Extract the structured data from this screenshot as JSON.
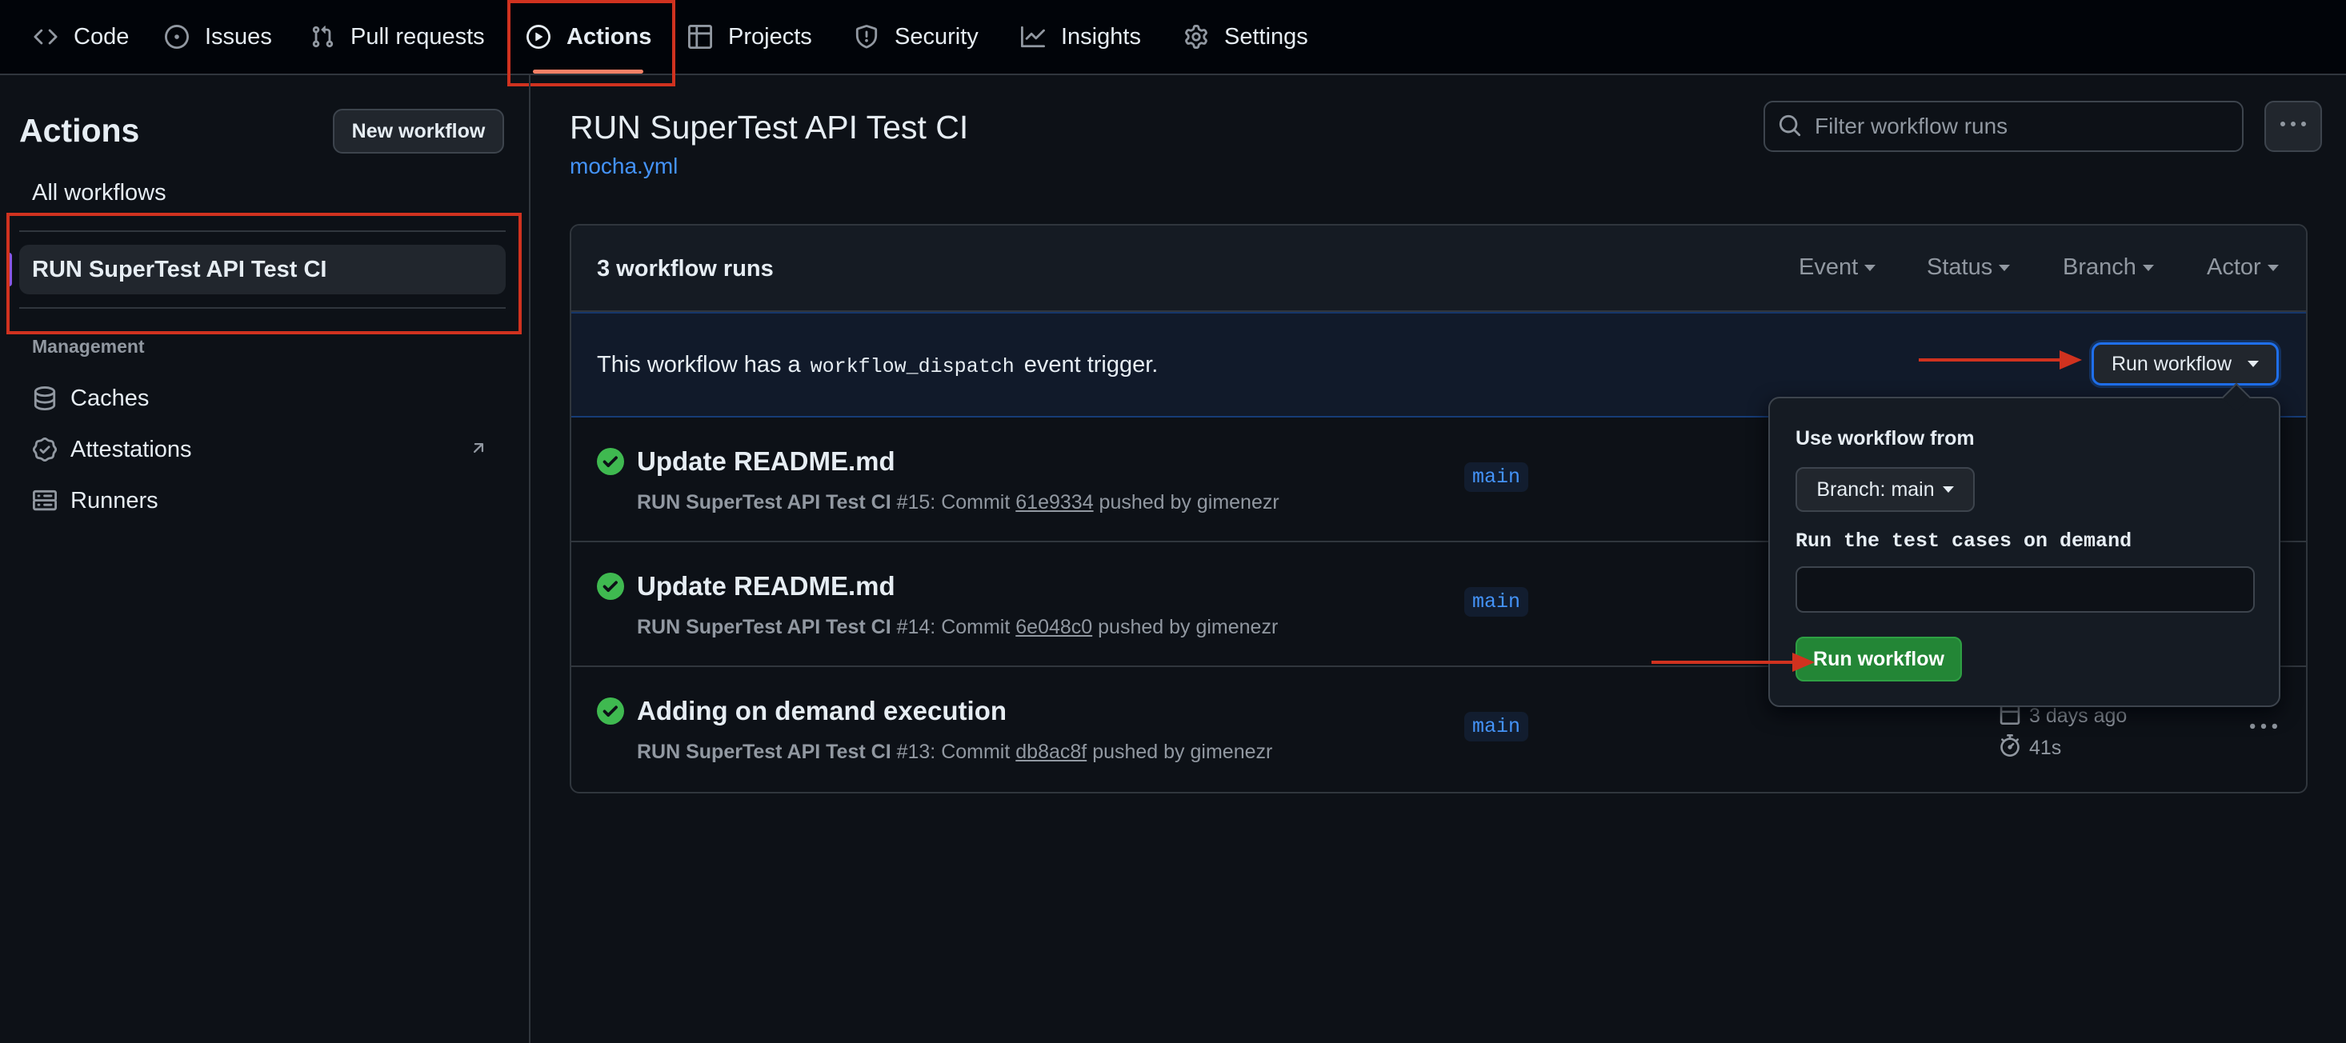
{
  "nav": {
    "tabs": [
      {
        "label": "Code",
        "icon": "code-icon"
      },
      {
        "label": "Issues",
        "icon": "issue-opened-icon"
      },
      {
        "label": "Pull requests",
        "icon": "pull-request-icon"
      },
      {
        "label": "Actions",
        "icon": "play-icon",
        "active": true
      },
      {
        "label": "Projects",
        "icon": "table-icon"
      },
      {
        "label": "Security",
        "icon": "shield-icon"
      },
      {
        "label": "Insights",
        "icon": "graph-icon"
      },
      {
        "label": "Settings",
        "icon": "gear-icon"
      }
    ]
  },
  "sidebar": {
    "title": "Actions",
    "new_workflow": "New workflow",
    "all_workflows": "All workflows",
    "selected_workflow": "RUN SuperTest API Test CI",
    "management_heading": "Management",
    "management_items": [
      {
        "label": "Caches",
        "icon": "database-icon"
      },
      {
        "label": "Attestations",
        "icon": "verified-icon"
      },
      {
        "label": "Runners",
        "icon": "server-icon"
      }
    ]
  },
  "main": {
    "title": "RUN SuperTest API Test CI",
    "file": "mocha.yml",
    "filter_placeholder": "Filter workflow runs",
    "runs_count": "3 workflow runs",
    "filters": [
      "Event",
      "Status",
      "Branch",
      "Actor"
    ],
    "banner": {
      "prefix": "This workflow has a",
      "code": "workflow_dispatch",
      "suffix": "event trigger."
    },
    "run_workflow_button": "Run workflow",
    "runs": [
      {
        "title": "Update README.md",
        "workflow": "RUN SuperTest API Test CI",
        "number": "#15: Commit",
        "commit": "61e9334",
        "pushed_by": "pushed by gimenezr",
        "branch": "main"
      },
      {
        "title": "Update README.md",
        "workflow": "RUN SuperTest API Test CI",
        "number": "#14: Commit",
        "commit": "6e048c0",
        "pushed_by": "pushed by gimenezr",
        "branch": "main"
      },
      {
        "title": "Adding on demand execution",
        "workflow": "RUN SuperTest API Test CI",
        "number": "#13: Commit",
        "commit": "db8ac8f",
        "pushed_by": "pushed by gimenezr",
        "branch": "main",
        "when": "3 days ago",
        "duration": "41s"
      }
    ]
  },
  "dropdown": {
    "use_from_label": "Use workflow from",
    "branch_button": "Branch: main",
    "input_label": "Run the test cases on demand",
    "input_value": "",
    "run_button": "Run workflow"
  },
  "colors": {
    "annotation_red": "#d0321f",
    "success_green": "#3fb950",
    "link_blue": "#4493f8",
    "run_green": "#238636"
  }
}
